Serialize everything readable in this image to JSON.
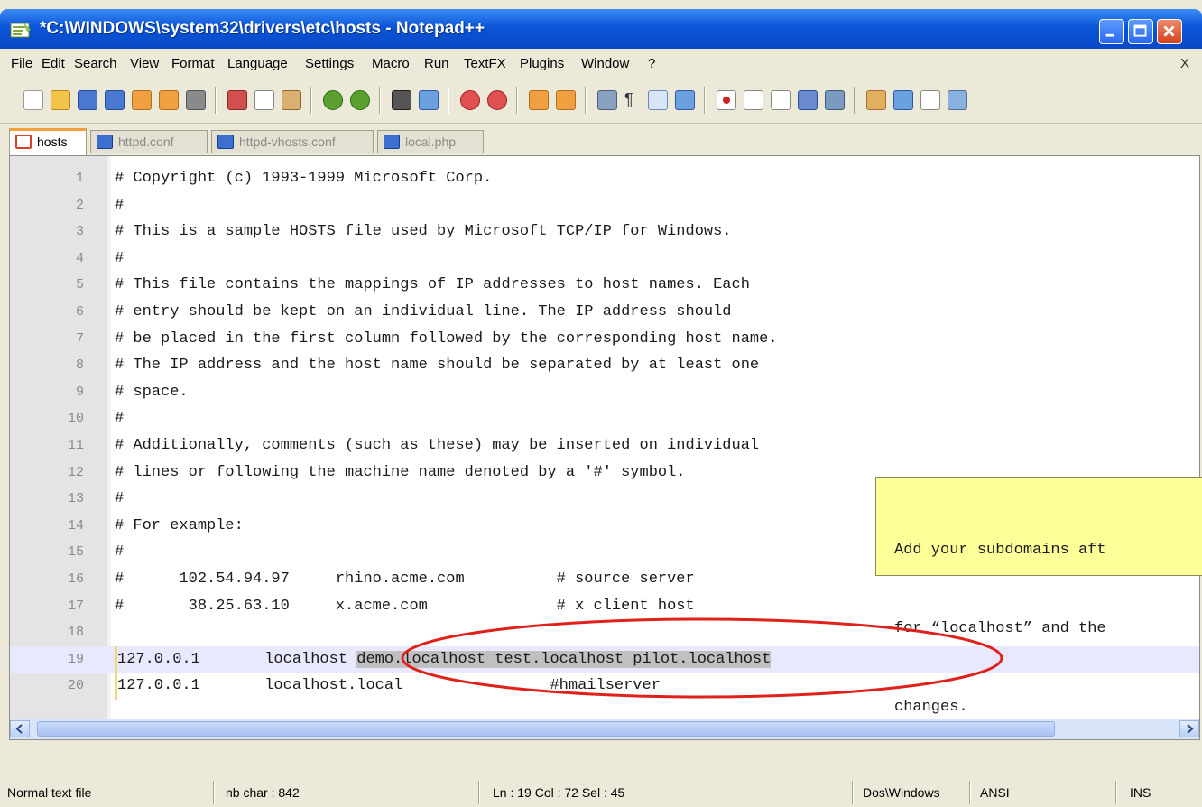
{
  "window": {
    "title": "*C:\\WINDOWS\\system32\\drivers\\etc\\hosts - Notepad++"
  },
  "menu": {
    "items": [
      "File",
      "Edit",
      "Search",
      "View",
      "Format",
      "Language",
      "Settings",
      "Macro",
      "Run",
      "TextFX",
      "Plugins",
      "Window",
      "?"
    ],
    "close_label": "X"
  },
  "toolbar": {
    "icons": [
      "new-file-icon",
      "open-file-icon",
      "save-icon",
      "save-all-icon",
      "close-icon",
      "close-all-icon",
      "print-icon",
      "cut-icon",
      "copy-icon",
      "paste-icon",
      "undo-icon",
      "redo-icon",
      "find-icon",
      "replace-icon",
      "zoom-in-icon",
      "zoom-out-icon",
      "sync-vertical-icon",
      "sync-horizontal-icon",
      "word-wrap-icon",
      "show-all-chars-icon",
      "indent-guide-icon",
      "user-lang-icon",
      "record-macro-icon",
      "stop-macro-icon",
      "play-macro-icon",
      "run-macro-multiple-icon",
      "save-macro-icon",
      "trim-icon",
      "full-screen-icon",
      "doc-map-icon",
      "spellcheck-icon"
    ]
  },
  "tabs": [
    {
      "label": "hosts",
      "active": true,
      "color": "#d9402a"
    },
    {
      "label": "httpd.conf",
      "active": false,
      "color": "#3b6fd0"
    },
    {
      "label": "httpd-vhosts.conf",
      "active": false,
      "color": "#3b6fd0"
    },
    {
      "label": "local.php",
      "active": false,
      "color": "#3b6fd0"
    }
  ],
  "editor": {
    "lines": [
      {
        "n": "1",
        "text": "# Copyright (c) 1993-1999 Microsoft Corp."
      },
      {
        "n": "2",
        "text": "#"
      },
      {
        "n": "3",
        "text": "# This is a sample HOSTS file used by Microsoft TCP/IP for Windows."
      },
      {
        "n": "4",
        "text": "#"
      },
      {
        "n": "5",
        "text": "# This file contains the mappings of IP addresses to host names. Each"
      },
      {
        "n": "6",
        "text": "# entry should be kept on an individual line. The IP address should"
      },
      {
        "n": "7",
        "text": "# be placed in the first column followed by the corresponding host name."
      },
      {
        "n": "8",
        "text": "# The IP address and the host name should be separated by at least one"
      },
      {
        "n": "9",
        "text": "# space."
      },
      {
        "n": "10",
        "text": "#"
      },
      {
        "n": "11",
        "text": "# Additionally, comments (such as these) may be inserted on individual"
      },
      {
        "n": "12",
        "text": "# lines or following the machine name denoted by a '#' symbol."
      },
      {
        "n": "13",
        "text": "#"
      },
      {
        "n": "14",
        "text": "# For example:"
      },
      {
        "n": "15",
        "text": "#"
      },
      {
        "n": "16",
        "text": "#      102.54.94.97     rhino.acme.com          # source server"
      },
      {
        "n": "17",
        "text": "#       38.25.63.10     x.acme.com              # x client host"
      },
      {
        "n": "18",
        "text": ""
      },
      {
        "n": "19",
        "text": "127.0.0.1       localhost ",
        "selected": "demo.localhost test.localhost pilot.localhost"
      },
      {
        "n": "20",
        "text": "127.0.0.1       localhost.local                #hmailserver"
      }
    ],
    "current_line": "19"
  },
  "annotation": {
    "lines": [
      "Add your subdomains aft",
      "for “localhost” and the",
      "changes."
    ]
  },
  "status": {
    "file_type": "Normal text file",
    "nb_char": "nb char : 842",
    "position": "Ln : 19   Col : 72   Sel : 45",
    "eol": "Dos\\Windows",
    "encoding": "ANSI",
    "mode": "INS"
  },
  "colors": {
    "title_bar": "#0a55d8",
    "current_line": "#e8e8ff",
    "selection": "#c0c0c0",
    "annotation_bg": "#ffff99",
    "ellipse": "#e0211b"
  }
}
